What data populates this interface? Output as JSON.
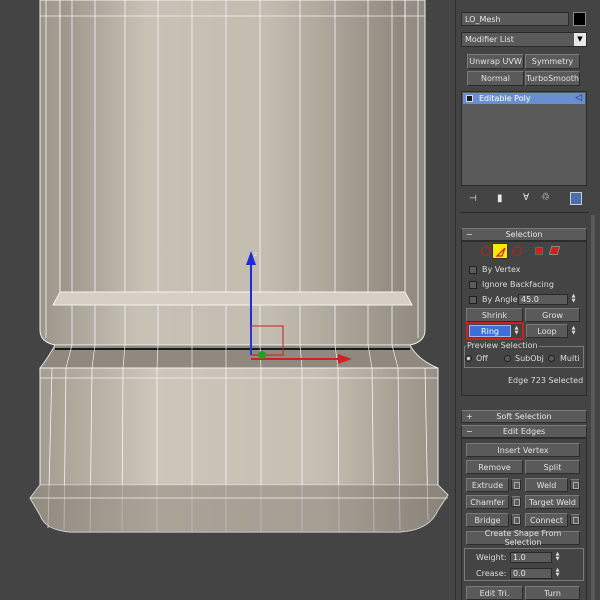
{
  "object_name": "LO_Mesh",
  "modifier_list": {
    "label": "Modifier List"
  },
  "modifier_buttons": [
    "Unwrap UVW",
    "Symmetry",
    "Normal",
    "TurboSmooth"
  ],
  "stack": {
    "item": "Editable Poly"
  },
  "selection": {
    "title": "Selection",
    "by_vertex": "By Vertex",
    "ignore_backfacing": "Ignore Backfacing",
    "by_angle": "By Angle:",
    "by_angle_value": "45.0",
    "shrink": "Shrink",
    "grow": "Grow",
    "ring": "Ring",
    "loop": "Loop",
    "preview_title": "Preview Selection",
    "preview_off": "Off",
    "preview_subobj": "SubObj",
    "preview_multi": "Multi",
    "status": "Edge 723 Selected"
  },
  "soft_selection": {
    "title": "Soft Selection"
  },
  "edit_edges": {
    "title": "Edit Edges",
    "insert_vertex": "Insert Vertex",
    "remove": "Remove",
    "split": "Split",
    "extrude": "Extrude",
    "weld": "Weld",
    "chamfer": "Chamfer",
    "target_weld": "Target Weld",
    "bridge": "Bridge",
    "connect": "Connect",
    "create_shape": "Create Shape From Selection",
    "weight_label": "Weight:",
    "weight_value": "1.0",
    "crease_label": "Crease:",
    "crease_value": "0.0",
    "edit_tri": "Edit Tri.",
    "turn": "Turn"
  },
  "colors": {
    "highlight_ring": "#cc1f1f",
    "active_button": "#3c6fd8",
    "yellow_edge_mode": "#ffe800"
  }
}
